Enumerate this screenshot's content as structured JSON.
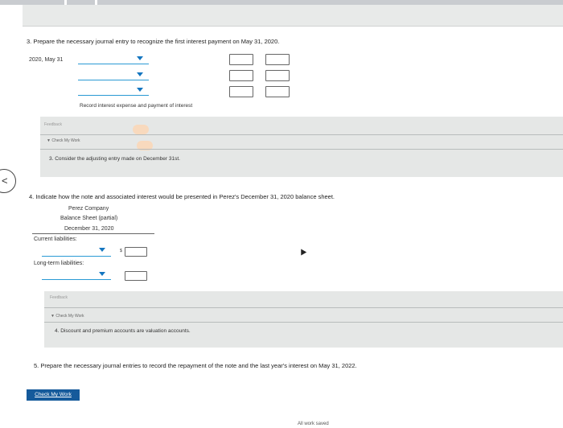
{
  "q3": {
    "text": "3. Prepare the necessary journal entry to recognize the first interest payment on May 31, 2020.",
    "date": "2020, May 31",
    "memo": "Record interest expense and payment of interest",
    "feedback_label": "Feedback",
    "check_label": "Check My Work",
    "hint": "3. Consider the adjusting entry made on December 31st."
  },
  "q4": {
    "text": "4. Indicate how the note and associated interest would be presented in Perez's December 31, 2020 balance sheet.",
    "company": "Perez Company",
    "statement": "Balance Sheet (partial)",
    "date": "December 31, 2020",
    "current_label": "Current liabilities:",
    "longterm_label": "Long-term liabilities:",
    "dollar": "$",
    "feedback_label": "Feedback",
    "check_label": "Check My Work",
    "hint": "4. Discount and premium accounts are valuation accounts."
  },
  "q5": {
    "text": "5. Prepare the necessary journal entries to record the repayment of the note and the last year's interest on May 31, 2022."
  },
  "check_button": "Check My Work",
  "status": "All work saved"
}
